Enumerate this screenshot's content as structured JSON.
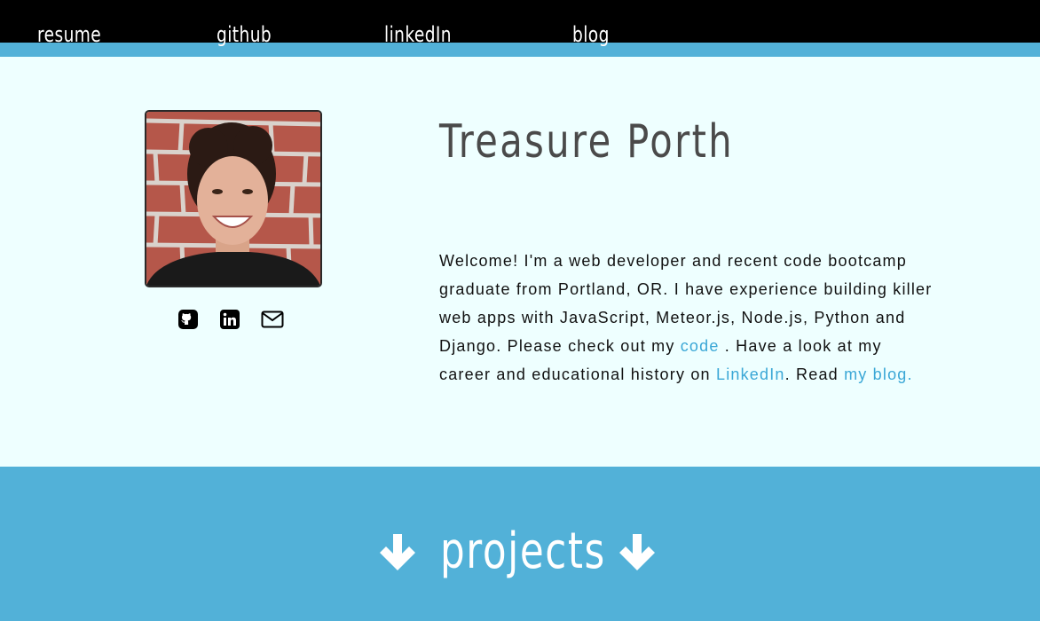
{
  "nav": {
    "items": [
      {
        "label": "resume"
      },
      {
        "label": "github"
      },
      {
        "label": "linkedIn"
      },
      {
        "label": "blog"
      }
    ]
  },
  "profile": {
    "name": "Treasure Porth",
    "social_icons": [
      "github-icon",
      "linkedin-icon",
      "envelope-icon"
    ]
  },
  "bio": {
    "part1": "Welcome! I'm a web developer and recent code bootcamp graduate from Portland, OR. I have experience building killer web apps with JavaScript, Meteor.js, Node.js, Python and Django. Please check out my ",
    "link_code": "code",
    "part2": " . Have a look at my career and educational history on ",
    "link_linkedin": "LinkedIn",
    "part3": ". Read ",
    "link_blog": "my blog."
  },
  "projects": {
    "title": "projects",
    "icon": "arrow-down-icon"
  },
  "colors": {
    "accent": "#52b1d8",
    "background": "#eeffff",
    "link": "#3aa7d6",
    "topbar": "#000000"
  }
}
